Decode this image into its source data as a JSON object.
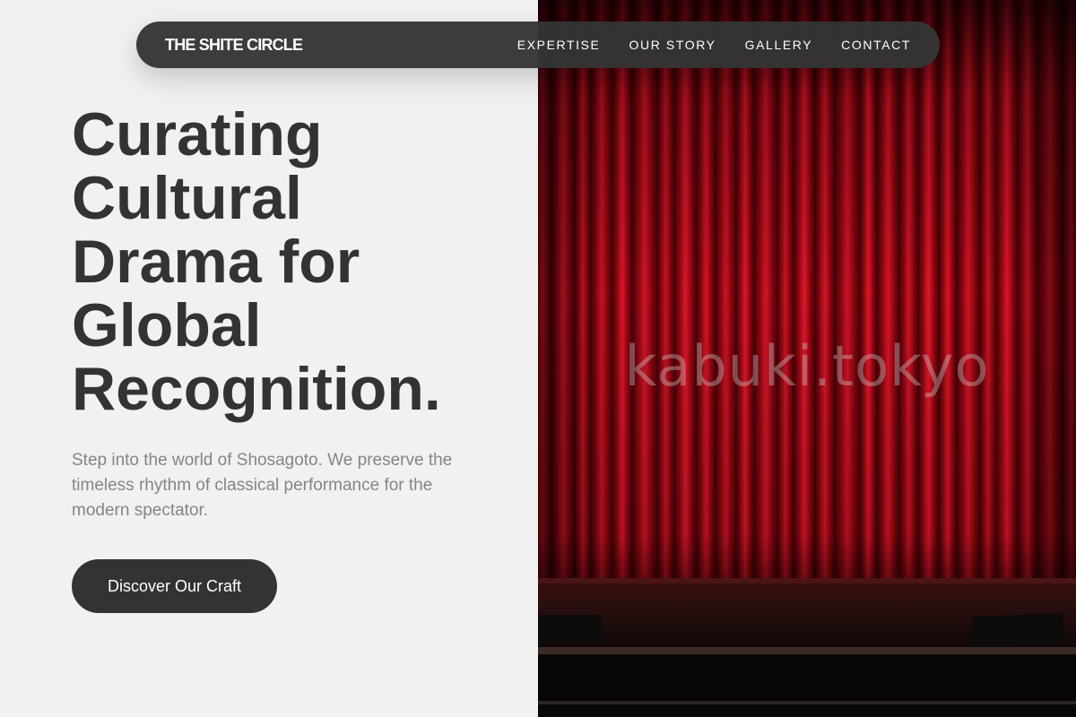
{
  "nav": {
    "brand": "THE SHITE CIRCLE",
    "links": [
      "EXPERTISE",
      "OUR STORY",
      "GALLERY",
      "CONTACT"
    ]
  },
  "hero": {
    "title_lines": [
      "Curating",
      "Cultural",
      "Drama for",
      "Global",
      "Recognition."
    ],
    "subtitle": "Step into the world of Shosagoto. We preserve the timeless rhythm of classical performance for the modern spectator.",
    "cta_label": "Discover Our Craft"
  },
  "image": {
    "watermark": "kabuki.tokyo",
    "subject": "red-stage-curtain"
  },
  "colors": {
    "background": "#f1f1f1",
    "text_dark": "#333333",
    "text_muted": "#858585",
    "navbar": "#343434",
    "curtain_red": "#c0101c"
  }
}
